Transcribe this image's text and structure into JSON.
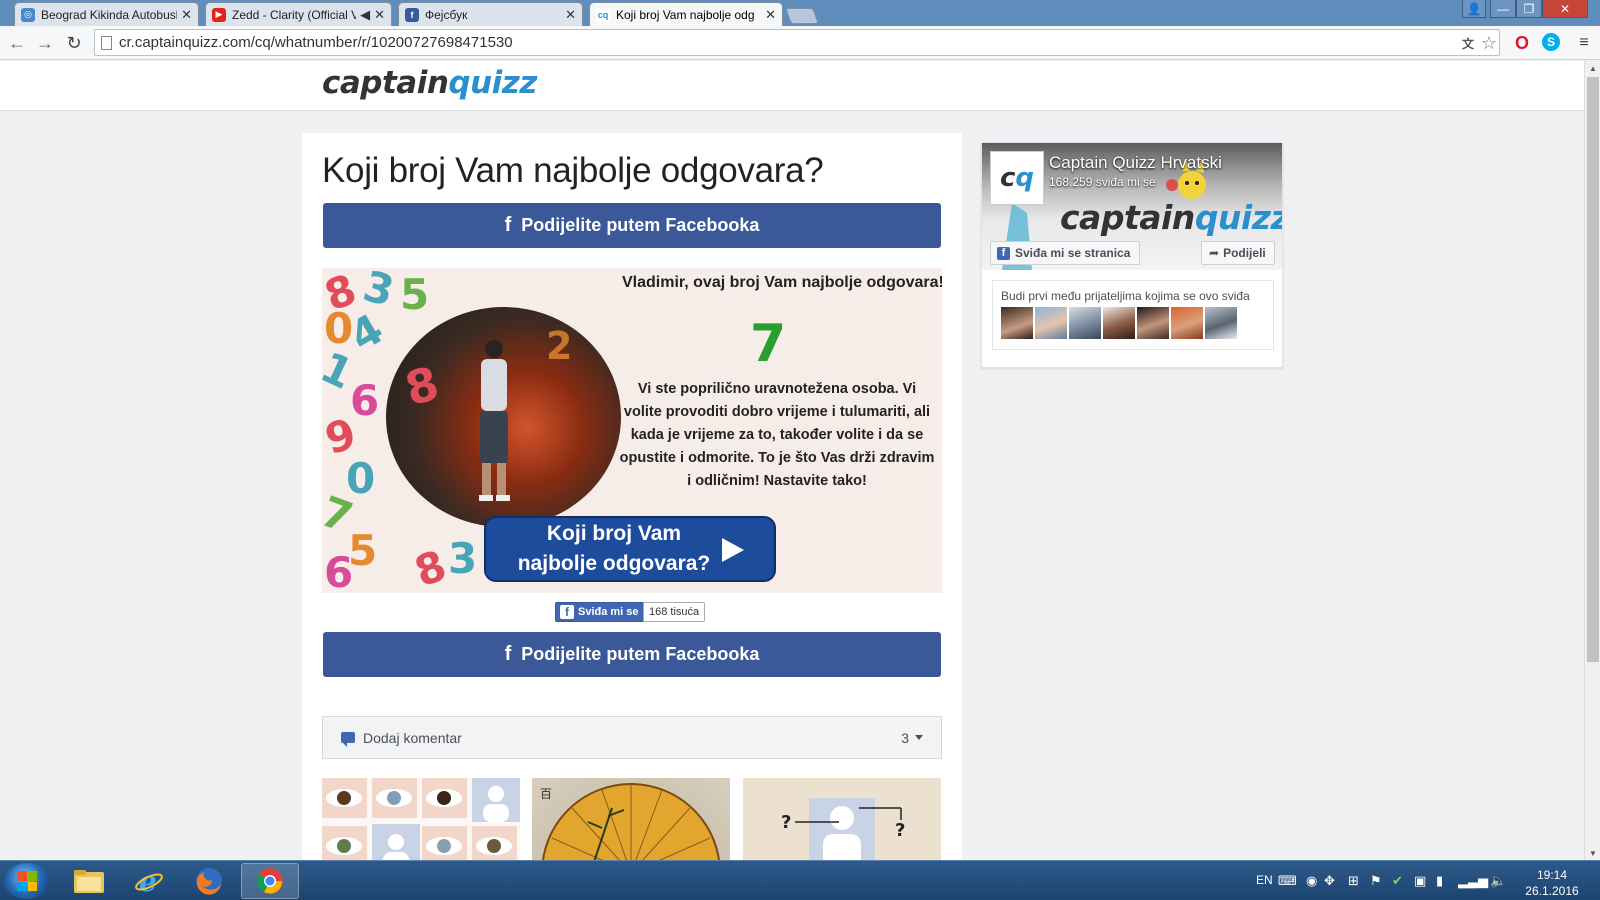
{
  "browser": {
    "tabs": [
      {
        "title": "Beograd Kikinda Autobusk",
        "icon_color": "#4a88c7"
      },
      {
        "title": "Zedd - Clarity (Official V",
        "icon_color": "#e62117"
      },
      {
        "title": "Фејсбук",
        "icon_color": "#3b5998"
      },
      {
        "title": "Koji broj Vam najbolje odg",
        "icon_color": "#2a8fce"
      }
    ],
    "url": "cr.captainquizz.com/cq/whatnumber/r/10200727698471530"
  },
  "site": {
    "logo_dark": "captain",
    "logo_light": "quizz"
  },
  "quiz": {
    "title": "Koji broj Vam najbolje odgovara?",
    "share_label": "Podijelite putem Facebooka",
    "result": {
      "heading": "Vladimir, ovaj broj Vam najbolje odgovara!",
      "number": "7",
      "description": "Vi ste poprilično uravnotežena osoba. Vi volite provoditi dobro vrijeme i tulumariti, ali kada je vrijeme za to, također volite i da se opustite i odmorite. To je što Vas drži zdravim i odličnim! Nastavite tako!",
      "cta_line1": "Koji broj Vam",
      "cta_line2": "najbolje odgovara?"
    },
    "like_label": "Sviđa mi se",
    "like_count": "168 tisuća",
    "comments_label": "Dodaj komentar",
    "comments_count": "3"
  },
  "fb_widget": {
    "page_name": "Captain Quizz Hrvatski",
    "likes": "168.259 sviđa mi se",
    "like_page_label": "Sviđa mi se stranica",
    "share_label": "Podijeli",
    "friends_text": "Budi prvi među prijateljima kojima se ovo sviđa"
  },
  "taskbar": {
    "lang": "EN",
    "time": "19:14",
    "date": "26.1.2016"
  },
  "colors": {
    "facebook_blue": "#3b5998",
    "brand_blue": "#2a8fce",
    "number_green": "#2a9d2f"
  }
}
